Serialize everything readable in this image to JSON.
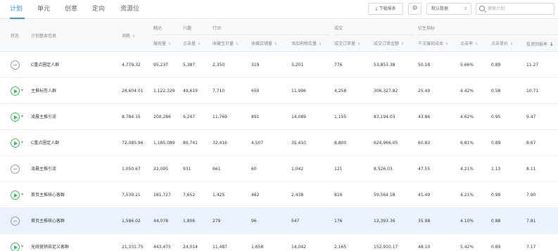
{
  "tabs": [
    "计划",
    "单元",
    "创意",
    "定向",
    "资源位"
  ],
  "toolbar": {
    "download_label": "下载报表",
    "data_select": "默认数据",
    "search_placeholder": "搜索计划"
  },
  "header": {
    "status": "状态",
    "plan_info": "计划基本信息",
    "spend": "消耗",
    "group_reach": "触达",
    "group_interest": "兴趣",
    "group_action": "行动",
    "group_deal": "成交",
    "group_derived": "衍生指标",
    "impressions": "展现量",
    "clicks": "点击量",
    "fav_items": "收藏宝贝量",
    "fav_shop": "收藏店铺量",
    "add_cart": "添加购物车量",
    "orders": "成交订单量",
    "gmv": "成交订单金额",
    "cpm": "千次展现成本",
    "ctr": "点击率",
    "cpc": "点击单价",
    "roi": "投资回报率"
  },
  "rows": [
    {
      "status": "paused",
      "name": "C重点圈定人群",
      "spend": "4,779.32",
      "impressions": "95,237",
      "clicks": "5,387",
      "fav_items": "2,350",
      "fav_shop": "319",
      "add_cart": "3,201",
      "orders": "776",
      "gmv": "53,853.38",
      "cpm": "50.18",
      "ctr": "5.66%",
      "cpc": "0.89",
      "roi": "11.27"
    },
    {
      "status": "active",
      "name": "主推标签人群",
      "spend": "28,604.01",
      "impressions": "1,122,329",
      "clicks": "49,619",
      "fav_items": "7,710",
      "fav_shop": "650",
      "add_cart": "11,996",
      "orders": "4,258",
      "gmv": "306,327.82",
      "cpm": "25.49",
      "ctr": "4.42%",
      "cpc": "0.58",
      "roi": "10.71"
    },
    {
      "status": "active",
      "name": "凌晨主推引流",
      "spend": "8,784.15",
      "impressions": "200,286",
      "clicks": "9,247",
      "fav_items": "11,769",
      "fav_shop": "891",
      "add_cart": "14,089",
      "orders": "1,155",
      "gmv": "83,194.03",
      "cpm": "43.86",
      "ctr": "4.62%",
      "cpc": "0.95",
      "roi": "9.47"
    },
    {
      "status": "active",
      "name": "C重点圈定人群",
      "spend": "72,085.96",
      "impressions": "1,185,089",
      "clicks": "80,741",
      "fav_items": "32,416",
      "fav_shop": "4,507",
      "add_cart": "35,410",
      "orders": "8,800",
      "gmv": "624,966.05",
      "cpm": "60.83",
      "ctr": "6.81%",
      "cpc": "0.89",
      "roi": "8.67"
    },
    {
      "status": "paused",
      "name": "凌晨主推引流",
      "spend": "1,050.67",
      "impressions": "22,095",
      "clicks": "931",
      "fav_items": "661",
      "fav_shop": "60",
      "add_cart": "1,042",
      "orders": "121",
      "gmv": "8,526.03",
      "cpm": "47.55",
      "ctr": "4.21%",
      "cpc": "1.13",
      "roi": "8.11"
    },
    {
      "status": "active",
      "name": "首页主推核心客群",
      "spend": "7,539.21",
      "impressions": "181,727",
      "clicks": "7,652",
      "fav_items": "1,425",
      "fav_shop": "462",
      "add_cart": "2,438",
      "orders": "816",
      "gmv": "59,564.18",
      "cpm": "41.49",
      "ctr": "4.21%",
      "cpc": "0.99",
      "roi": "7.90"
    },
    {
      "status": "paused",
      "name": "首页主推核心客群",
      "spend": "1,586.02",
      "impressions": "44,078",
      "clicks": "1,806",
      "fav_items": "279",
      "fav_shop": "96",
      "add_cart": "547",
      "orders": "176",
      "gmv": "12,393.36",
      "cpm": "35.98",
      "ctr": "4.10%",
      "cpc": "0.88",
      "roi": "7.81"
    },
    {
      "status": "active",
      "name": "无线营销自定义客群",
      "spend": "21,331.75",
      "impressions": "443,475",
      "clicks": "24,014",
      "fav_items": "11,487",
      "fav_shop": "1,658",
      "add_cart": "14,042",
      "orders": "2,165",
      "gmv": "152,910.17",
      "cpm": "48.10",
      "ctr": "5.42%",
      "cpc": "0.89",
      "roi": "7.17"
    }
  ],
  "highlighted_row": 6,
  "colors": {
    "accent": "#3a8ee6",
    "active": "#3bb75c",
    "paused": "#9a9a9a",
    "highlight": "#eaf3fd"
  }
}
